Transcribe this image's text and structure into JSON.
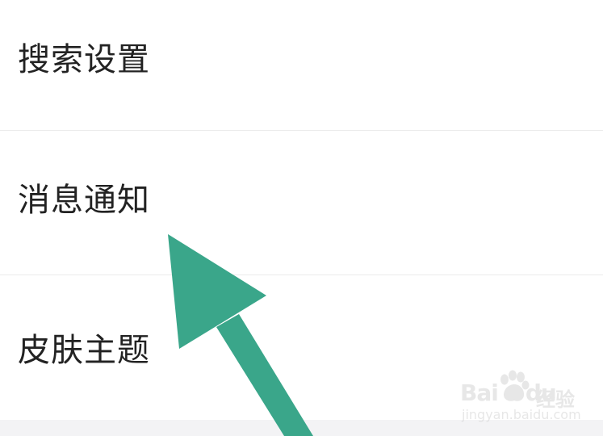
{
  "settings": {
    "items": [
      {
        "label": "搜索设置"
      },
      {
        "label": "消息通知"
      },
      {
        "label": "皮肤主题"
      }
    ]
  },
  "annotation": {
    "arrow_color": "#3aa68a",
    "arrow_icon": "arrow-up-left-icon"
  },
  "watermark": {
    "brand_text": "Bai",
    "brand_suffix": "du",
    "product_text": "经验",
    "url_text": "jingyan.baidu.com"
  },
  "colors": {
    "background": "#ffffff",
    "text": "#222222",
    "divider": "#ebebeb",
    "bottom_band": "#f3f3f5"
  }
}
